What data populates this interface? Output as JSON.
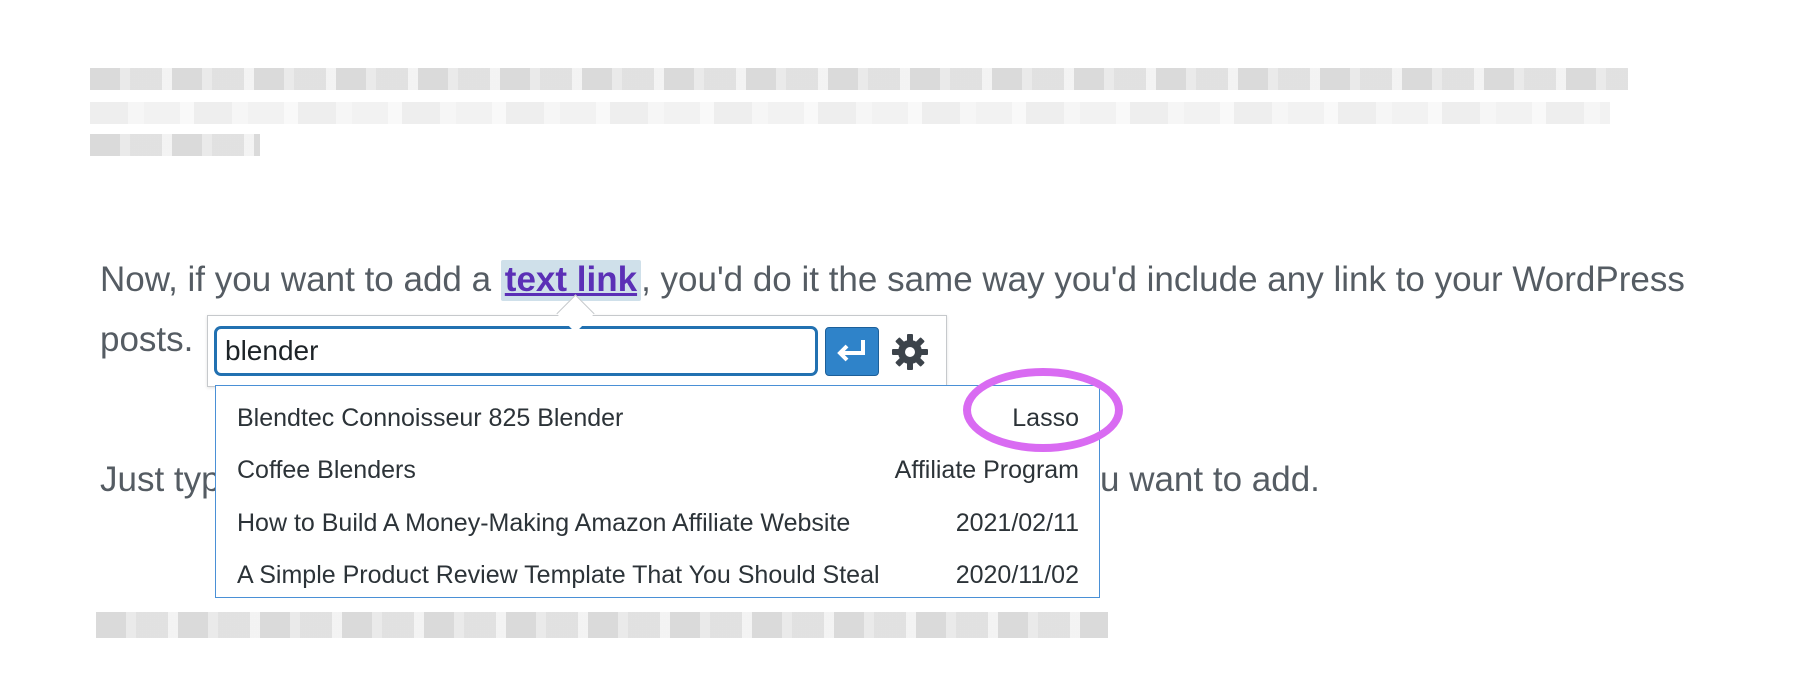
{
  "paragraph1": {
    "before": "Now, if you want to add a ",
    "link_text": "text link",
    "after": ", you'd do it the same way you'd include any link to your WordPress",
    "line2": "posts."
  },
  "paragraph2": {
    "start": "Just typ",
    "end": "u want to add."
  },
  "link_popup": {
    "input_value": "blender",
    "apply_icon": "return-arrow-icon",
    "settings_icon": "gear-icon",
    "accent_color": "#2f83c9"
  },
  "suggestions": [
    {
      "title": "Blendtec Connoisseur 825 Blender",
      "meta": "Lasso"
    },
    {
      "title": "Coffee Blenders",
      "meta": "Affiliate Program"
    },
    {
      "title": "How to Build A Money-Making Amazon Affiliate Website",
      "meta": "2021/02/11"
    },
    {
      "title": "A Simple Product Review Template That You Should Steal",
      "meta": "2020/11/02"
    }
  ],
  "annotation_color": "#d96bf2"
}
